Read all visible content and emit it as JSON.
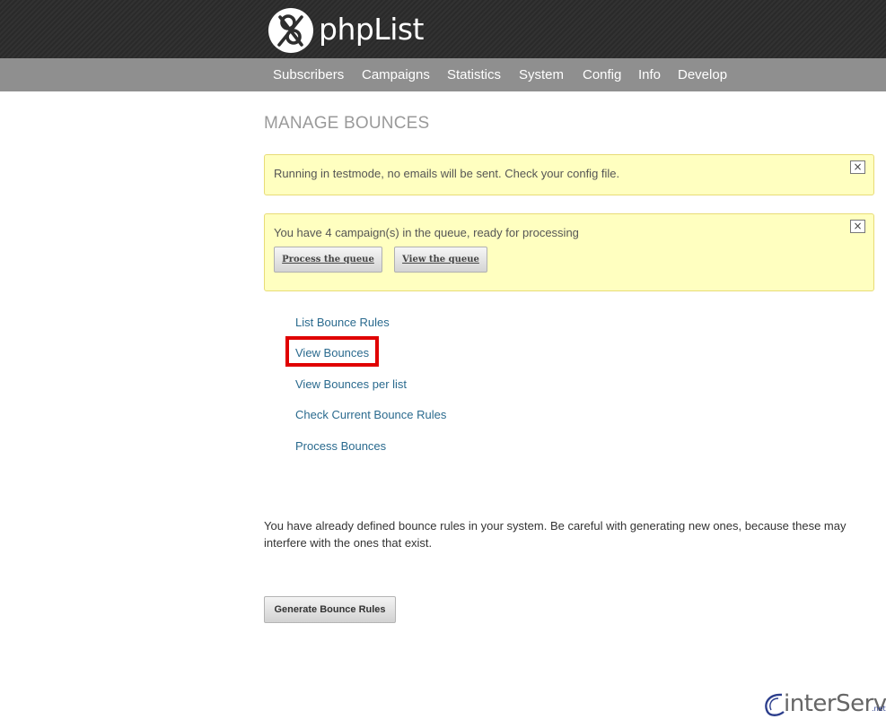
{
  "app": {
    "logo_text": "phpList"
  },
  "nav": {
    "items": [
      {
        "label": "Subscribers"
      },
      {
        "label": "Campaigns"
      },
      {
        "label": "Statistics"
      },
      {
        "label": "System"
      },
      {
        "label": "Config"
      },
      {
        "label": "Info"
      },
      {
        "label": "Develop"
      }
    ]
  },
  "page": {
    "title": "MANAGE BOUNCES"
  },
  "notices": {
    "testmode": {
      "text": "Running in testmode, no emails will be sent. Check your config file.",
      "close_icon": "×"
    },
    "queue": {
      "text": "You have 4 campaign(s) in the queue, ready for processing",
      "close_icon": "×",
      "process_label": "Process the queue",
      "view_label": "View the queue"
    }
  },
  "menu": {
    "items": [
      {
        "label": "List Bounce Rules"
      },
      {
        "label": "View Bounces"
      },
      {
        "label": "View Bounces per list"
      },
      {
        "label": "Check Current Bounce Rules"
      },
      {
        "label": "Process Bounces"
      }
    ],
    "highlighted": "View Bounces",
    "highlight_color": "#e00000"
  },
  "info": {
    "paragraph": "You have already defined bounce rules in your system. Be careful with generating new ones, because these may interfere with the ones that exist."
  },
  "actions": {
    "generate_label": "Generate Bounce Rules"
  },
  "footer": {
    "brand_text": "interServer",
    "brand_suffix": ".net"
  },
  "colors": {
    "navbar": "#8f8f8f",
    "notice_bg": "#ffffc0",
    "link": "#2a6a8e",
    "title": "#9a9a9a"
  }
}
